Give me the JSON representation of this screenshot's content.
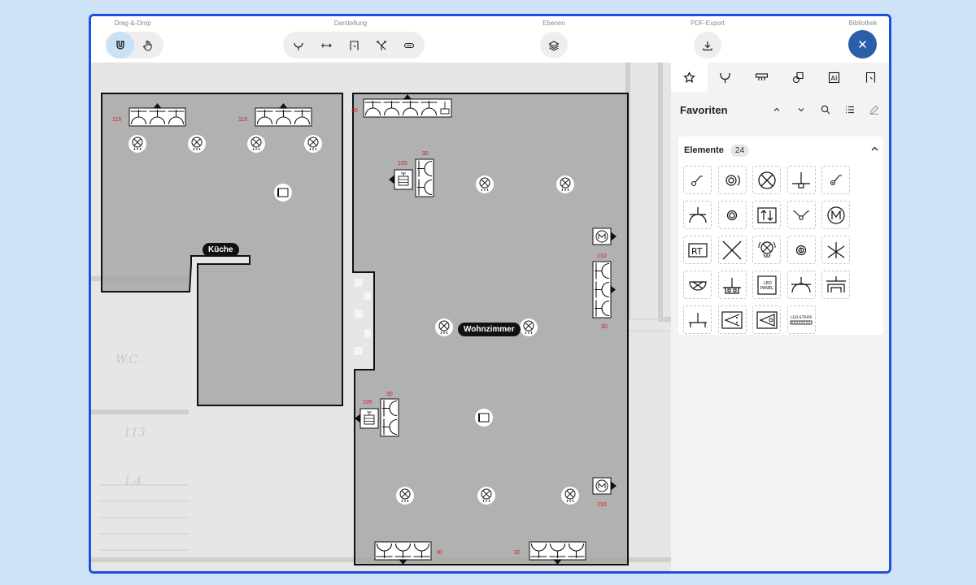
{
  "toolbar": {
    "groups": [
      {
        "label": "Drag-&-Drop"
      },
      {
        "label": "Darstellung"
      },
      {
        "label": "Ebenen"
      },
      {
        "label": "PDF-Export"
      },
      {
        "label": "Bibliothek"
      }
    ],
    "close_glyph": "✕"
  },
  "plan": {
    "rooms": [
      {
        "name": "Küche"
      },
      {
        "name": "Wohnzimmer"
      }
    ],
    "dimensions": [
      "115",
      "115",
      "30",
      "105",
      "30",
      "210",
      "30",
      "105",
      "30",
      "210",
      "30",
      "30"
    ],
    "dimension_color": "#d42020"
  },
  "sidebar": {
    "title": "Favoriten",
    "section_title": "Elemente",
    "count": "24",
    "element_labels": {
      "rt": "RT",
      "led_panel_1": "LED",
      "led_panel_2": "PANEL",
      "led_stripe": "LED-STRIPE"
    }
  },
  "colors": {
    "accent": "#1f4fe0",
    "close": "#2c5da8",
    "active": "#cbe1f6",
    "room_fill": "#9c9c9c"
  }
}
